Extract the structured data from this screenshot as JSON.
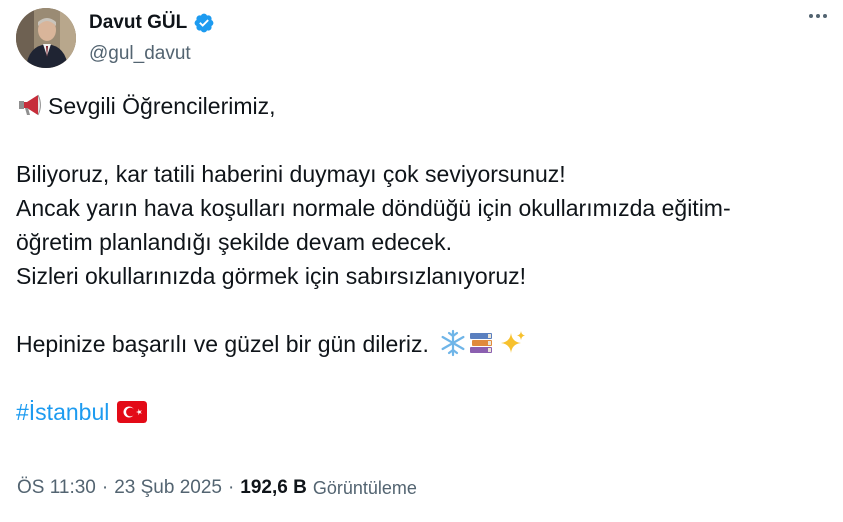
{
  "author": {
    "display_name": "Davut GÜL",
    "handle": "@gul_davut",
    "verified": true,
    "avatar_icon": "profile-photo"
  },
  "tweet": {
    "greeting": "Sevgili Öğrencilerimiz,",
    "lines": [
      "Biliyoruz, kar tatili haberini duymayı çok seviyorsunuz!",
      "Ancak yarın hava koşulları normale döndüğü için okullarımızda eğitim-",
      "öğretim planlandığı şekilde devam edecek.",
      "Sizleri okullarınızda görmek için sabırsızlanıyoruz!"
    ],
    "closing": "Hepinize başarılı ve güzel bir gün dileriz.",
    "hashtag": "#İstanbul",
    "emojis": [
      "megaphone-icon",
      "snowflake-icon",
      "books-icon",
      "sparkles-icon",
      "turkey-flag-icon"
    ]
  },
  "meta": {
    "time": "ÖS 11:30",
    "date": "23 Şub 2025",
    "views_count": "192,6 B",
    "views_label": "Görüntüleme",
    "separator": "·"
  },
  "colors": {
    "text": "#0f1419",
    "secondary": "#536471",
    "link": "#1d9bf0",
    "verified": "#1d9bf0"
  }
}
